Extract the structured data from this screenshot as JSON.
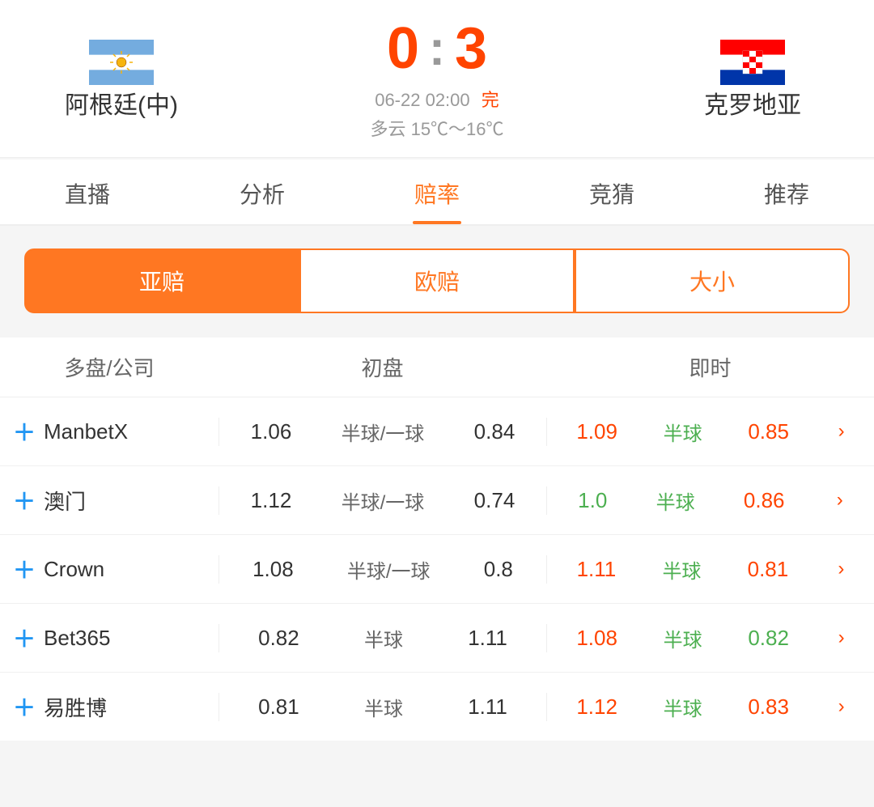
{
  "match": {
    "team_left": "阿根廷(中)",
    "team_right": "克罗地亚",
    "score_left": "0",
    "score_right": "3",
    "colon": ":",
    "date_time": "06-22 02:00",
    "status": "完",
    "weather": "多云  15℃～16℃"
  },
  "tabs": [
    {
      "id": "live",
      "label": "直播",
      "active": false
    },
    {
      "id": "analysis",
      "label": "分析",
      "active": false
    },
    {
      "id": "odds",
      "label": "赔率",
      "active": true
    },
    {
      "id": "predict",
      "label": "竞猜",
      "active": false
    },
    {
      "id": "recommend",
      "label": "推荐",
      "active": false
    }
  ],
  "subtabs": [
    {
      "id": "asia",
      "label": "亚赔",
      "active": true
    },
    {
      "id": "euro",
      "label": "欧赔",
      "active": false
    },
    {
      "id": "size",
      "label": "大小",
      "active": false
    }
  ],
  "table_headers": {
    "company": "多盘/公司",
    "initial": "初盘",
    "live": "即时"
  },
  "odds_rows": [
    {
      "company": "ManbetX",
      "init_left": "1.06",
      "init_mid": "半球/一球",
      "init_right": "0.84",
      "live_left": "1.09",
      "live_left_color": "orange",
      "live_mid": "半球",
      "live_mid_color": "green",
      "live_right": "0.85",
      "live_right_color": "orange"
    },
    {
      "company": "澳门",
      "init_left": "1.12",
      "init_mid": "半球/一球",
      "init_right": "0.74",
      "live_left": "1.0",
      "live_left_color": "green",
      "live_mid": "半球",
      "live_mid_color": "green",
      "live_right": "0.86",
      "live_right_color": "orange"
    },
    {
      "company": "Crown",
      "init_left": "1.08",
      "init_mid": "半球/一球",
      "init_right": "0.8",
      "live_left": "1.11",
      "live_left_color": "orange",
      "live_mid": "半球",
      "live_mid_color": "green",
      "live_right": "0.81",
      "live_right_color": "orange"
    },
    {
      "company": "Bet365",
      "init_left": "0.82",
      "init_mid": "半球",
      "init_right": "1.11",
      "live_left": "1.08",
      "live_left_color": "orange",
      "live_mid": "半球",
      "live_mid_color": "green",
      "live_right": "0.82",
      "live_right_color": "green"
    },
    {
      "company": "易胜博",
      "init_left": "0.81",
      "init_mid": "半球",
      "init_right": "1.11",
      "live_left": "1.12",
      "live_left_color": "orange",
      "live_mid": "半球",
      "live_mid_color": "green",
      "live_right": "0.83",
      "live_right_color": "orange"
    }
  ],
  "colors": {
    "orange": "#ff4400",
    "green": "#4CAF50",
    "blue": "#2196F3",
    "active_tab": "#ff7722"
  }
}
